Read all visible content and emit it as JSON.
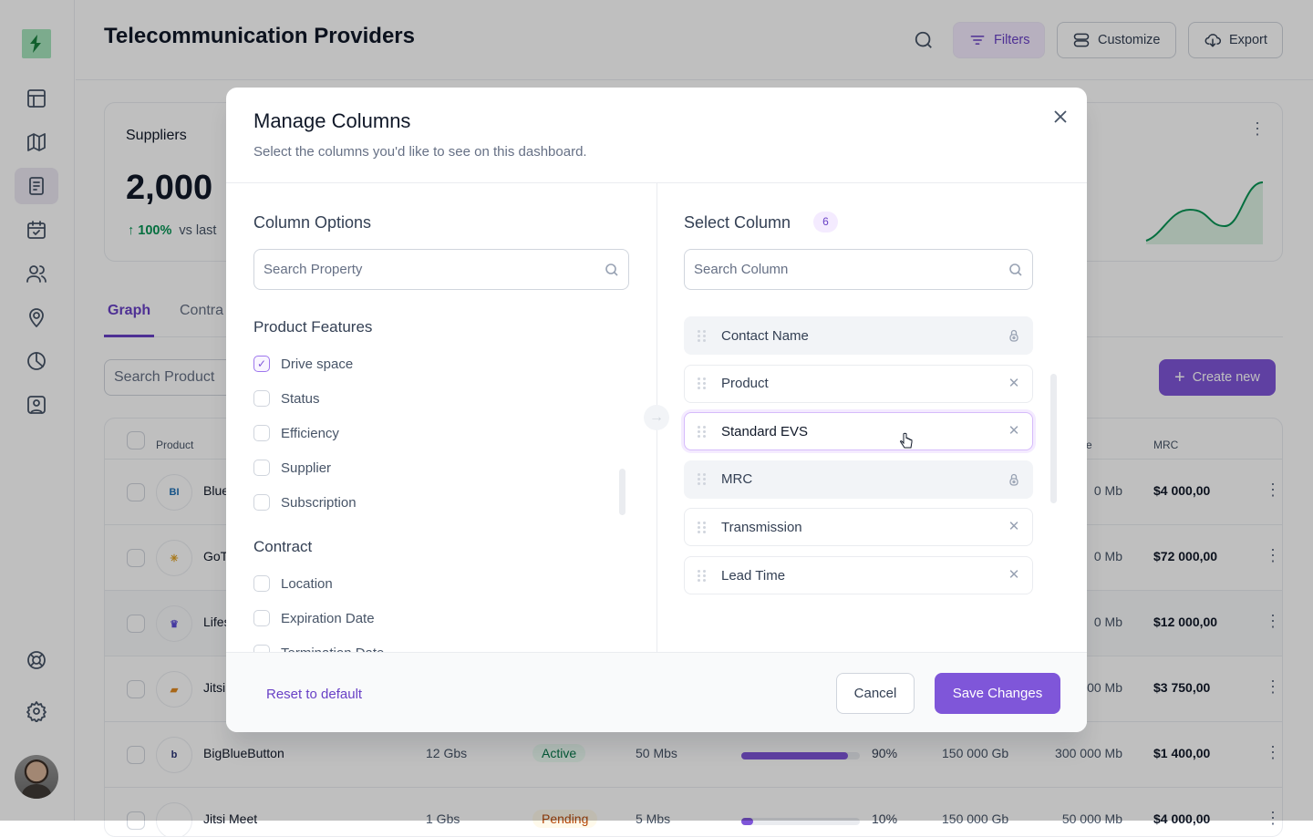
{
  "app": {
    "title": "Telecommunication Providers"
  },
  "sidebar": {
    "items": [
      {
        "icon": "layout-icon"
      },
      {
        "icon": "map-icon"
      },
      {
        "icon": "document-icon",
        "active": true
      },
      {
        "icon": "calendar-check-icon"
      },
      {
        "icon": "users-icon"
      },
      {
        "icon": "location-pin-icon"
      },
      {
        "icon": "pie-chart-icon"
      },
      {
        "icon": "contact-card-icon"
      }
    ],
    "bottom": [
      {
        "icon": "lifebuoy-icon"
      },
      {
        "icon": "gear-icon"
      }
    ]
  },
  "header": {
    "filters_label": "Filters",
    "customize_label": "Customize",
    "export_label": "Export"
  },
  "stats": {
    "label": "Suppliers",
    "value": "2,000",
    "change": "100%",
    "change_suffix": "vs last"
  },
  "tabs": [
    {
      "label": "Graph",
      "active": true
    },
    {
      "label": "Contra"
    }
  ],
  "search": {
    "placeholder": "Search Product"
  },
  "create_label": "Create new",
  "table": {
    "headers": {
      "product": "Product",
      "volume": "me",
      "mrc": "MRC"
    },
    "rows": [
      {
        "name": "Blue",
        "logo": "BI",
        "logo_color": "#1e6fb5",
        "volume": "0 Mb",
        "mrc": "$4 000,00"
      },
      {
        "name": "GoT",
        "logo": "✳",
        "logo_color": "#e0a020",
        "volume": "0 Mb",
        "mrc": "$72 000,00"
      },
      {
        "name": "Lifes",
        "logo": "♛",
        "logo_color": "#5b4bd6",
        "volume": "0 Mb",
        "mrc": "$12 000,00",
        "highlight": true
      },
      {
        "name": "Jitsi",
        "logo": "▰",
        "logo_color": "#e08a20",
        "volume": "00 Mb",
        "mrc": "$3 750,00"
      },
      {
        "name": "BigBlueButton",
        "logo": "b",
        "logo_color": "#283274",
        "drive": "12 Gbs",
        "status": "Active",
        "speed": "50 Mbs",
        "progress": 90,
        "pct": "90%",
        "storage": "150 000 Gb",
        "volume": "300 000 Mb",
        "mrc": "$1 400,00"
      },
      {
        "name": "Jitsi Meet",
        "logo": "",
        "logo_color": "#999",
        "drive": "1 Gbs",
        "status": "Pending",
        "speed": "5 Mbs",
        "progress": 10,
        "pct": "10%",
        "storage": "150 000 Gb",
        "volume": "50 000 Mb",
        "mrc": "$4 000,00"
      }
    ]
  },
  "modal": {
    "title": "Manage Columns",
    "subtitle": "Select the columns you'd like to see on this dashboard.",
    "left": {
      "heading": "Column Options",
      "search_placeholder": "Search Property",
      "groups": [
        {
          "title": "Product Features",
          "options": [
            {
              "label": "Drive space",
              "checked": true
            },
            {
              "label": "Status",
              "checked": false
            },
            {
              "label": "Efficiency",
              "checked": false
            },
            {
              "label": "Supplier",
              "checked": false
            },
            {
              "label": "Subscription",
              "checked": false
            }
          ]
        },
        {
          "title": "Contract",
          "options": [
            {
              "label": "Location",
              "checked": false
            },
            {
              "label": "Expiration Date",
              "checked": false
            },
            {
              "label": "Termination Date",
              "checked": false
            }
          ]
        }
      ]
    },
    "right": {
      "heading": "Select Column",
      "count": "6",
      "search_placeholder": "Search Column",
      "columns": [
        {
          "label": "Contact Name",
          "locked": true
        },
        {
          "label": "Product",
          "locked": false
        },
        {
          "label": "Standard EVS",
          "locked": false,
          "hover": true
        },
        {
          "label": "MRC",
          "locked": true
        },
        {
          "label": "Transmission",
          "locked": false
        },
        {
          "label": "Lead Time",
          "locked": false
        }
      ]
    },
    "reset_label": "Reset to default",
    "cancel_label": "Cancel",
    "save_label": "Save Changes"
  },
  "colors": {
    "accent": "#7f56d9",
    "success": "#079455",
    "logo_bg": "#a6e4bd"
  }
}
